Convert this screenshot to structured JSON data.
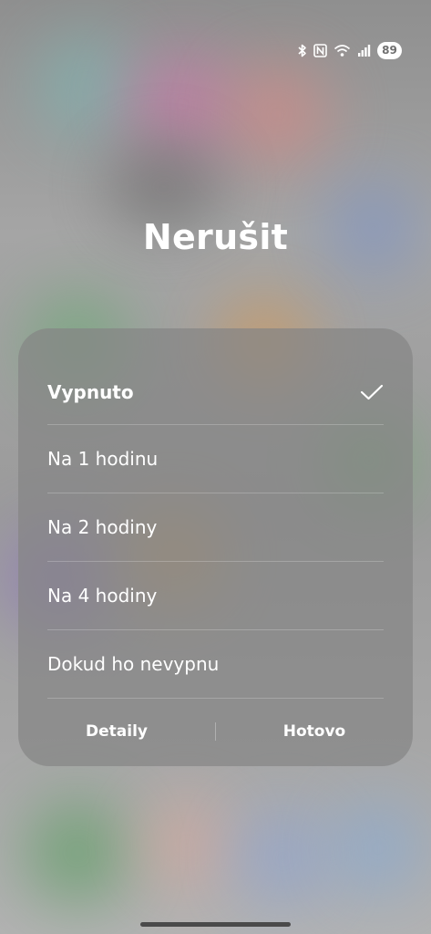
{
  "status_bar": {
    "icons": [
      "bluetooth-icon",
      "nfc-icon",
      "wifi-icon",
      "signal-icon"
    ],
    "battery_level": "89"
  },
  "title": "Nerušit",
  "options": [
    {
      "label": "Vypnuto",
      "selected": true
    },
    {
      "label": "Na 1 hodinu",
      "selected": false
    },
    {
      "label": "Na 2 hodiny",
      "selected": false
    },
    {
      "label": "Na 4 hodiny",
      "selected": false
    },
    {
      "label": "Dokud ho nevypnu",
      "selected": false
    }
  ],
  "footer": {
    "details_label": "Detaily",
    "done_label": "Hotovo"
  },
  "colors": {
    "panel": "#848484",
    "text": "#ffffff",
    "battery_bg": "#ffffff"
  }
}
